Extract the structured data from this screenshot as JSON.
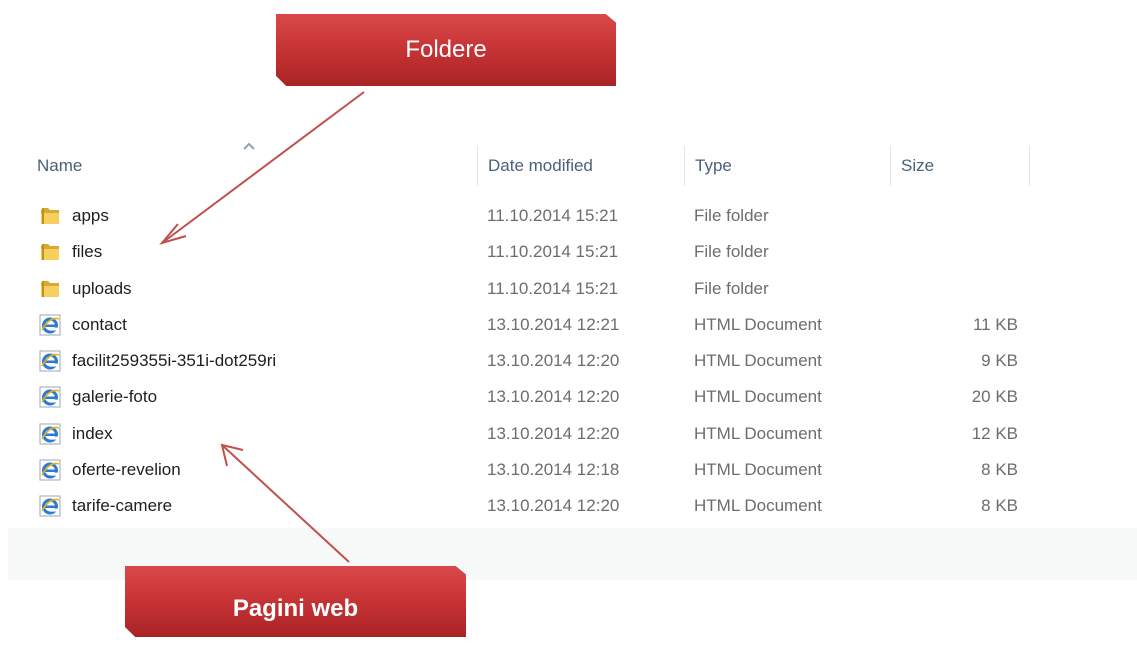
{
  "annotations": {
    "top_banner": "Foldere",
    "bottom_banner": "Pagini web",
    "banner_color": "#c63335",
    "arrow_color": "#c0504d"
  },
  "columns": {
    "name": "Name",
    "date": "Date modified",
    "type": "Type",
    "size": "Size"
  },
  "files": [
    {
      "name": "apps",
      "date": "11.10.2014 15:21",
      "type": "File folder",
      "size": "",
      "icon": "folder-icon"
    },
    {
      "name": "files",
      "date": "11.10.2014 15:21",
      "type": "File folder",
      "size": "",
      "icon": "folder-icon"
    },
    {
      "name": "uploads",
      "date": "11.10.2014 15:21",
      "type": "File folder",
      "size": "",
      "icon": "folder-icon"
    },
    {
      "name": "contact",
      "date": "13.10.2014 12:21",
      "type": "HTML Document",
      "size": "11 KB",
      "icon": "html-document-icon"
    },
    {
      "name": "facilit259355i-351i-dot259ri",
      "date": "13.10.2014 12:20",
      "type": "HTML Document",
      "size": "9 KB",
      "icon": "html-document-icon"
    },
    {
      "name": "galerie-foto",
      "date": "13.10.2014 12:20",
      "type": "HTML Document",
      "size": "20 KB",
      "icon": "html-document-icon"
    },
    {
      "name": "index",
      "date": "13.10.2014 12:20",
      "type": "HTML Document",
      "size": "12 KB",
      "icon": "html-document-icon"
    },
    {
      "name": "oferte-revelion",
      "date": "13.10.2014 12:18",
      "type": "HTML Document",
      "size": "8 KB",
      "icon": "html-document-icon"
    },
    {
      "name": "tarife-camere",
      "date": "13.10.2014 12:20",
      "type": "HTML Document",
      "size": "8 KB",
      "icon": "html-document-icon"
    }
  ]
}
